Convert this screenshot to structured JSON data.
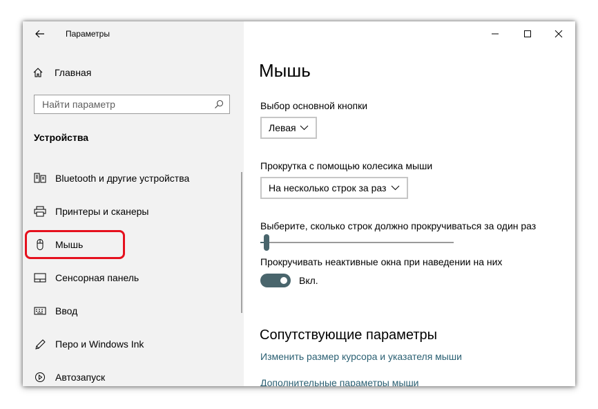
{
  "window": {
    "title": "Параметры",
    "controls": [
      "minimize-icon",
      "maximize-icon",
      "close-icon"
    ]
  },
  "sidebar": {
    "home_label": "Главная",
    "search_placeholder": "Найти параметр",
    "section_title": "Устройства",
    "items": [
      {
        "label": "Bluetooth и другие устройства",
        "icon": "bluetooth-devices-icon"
      },
      {
        "label": "Принтеры и сканеры",
        "icon": "printer-icon"
      },
      {
        "label": "Мышь",
        "icon": "mouse-icon",
        "selected": true
      },
      {
        "label": "Сенсорная панель",
        "icon": "touchpad-icon"
      },
      {
        "label": "Ввод",
        "icon": "keyboard-icon"
      },
      {
        "label": "Перо и Windows Ink",
        "icon": "pen-icon"
      },
      {
        "label": "Автозапуск",
        "icon": "autoplay-icon"
      }
    ]
  },
  "main": {
    "title": "Мышь",
    "primary_button": {
      "label": "Выбор основной кнопки",
      "value": "Левая"
    },
    "wheel_scroll": {
      "label": "Прокрутка с помощью колесика мыши",
      "value": "На несколько строк за раз"
    },
    "lines_slider": {
      "label": "Выберите, сколько строк должно прокручиваться за один раз",
      "fraction": 0.02
    },
    "inactive_scroll": {
      "label": "Прокручивать неактивные окна при наведении на них",
      "state": "Вкл.",
      "on": true
    },
    "related": {
      "title": "Сопутствующие параметры",
      "links": [
        "Изменить размер курсора и указателя мыши",
        "Дополнительные параметры мыши"
      ]
    }
  },
  "colors": {
    "accent": "#49656c",
    "link": "#2a5f72",
    "highlight_box": "#e5101d",
    "sidebar_bg": "#f2f2f2"
  }
}
